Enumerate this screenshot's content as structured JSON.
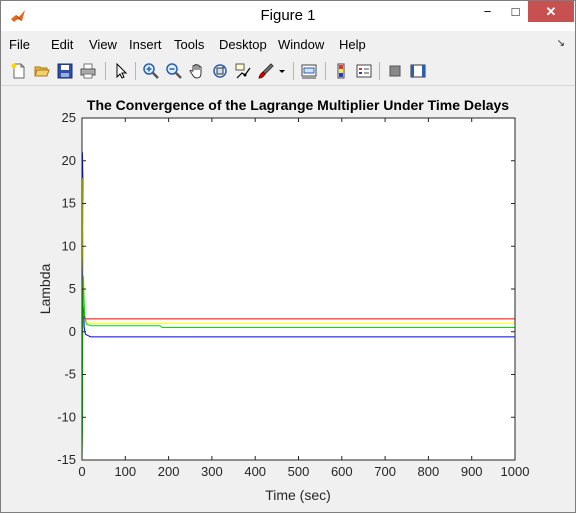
{
  "window": {
    "title": "Figure 1",
    "controls": {
      "minimize": "−",
      "maximize": "□",
      "close": "✕"
    }
  },
  "menu": {
    "items": [
      "File",
      "Edit",
      "View",
      "Insert",
      "Tools",
      "Desktop",
      "Window",
      "Help"
    ],
    "dock_arrow": "↘"
  },
  "toolbar": {
    "buttons": [
      {
        "name": "new-figure-icon"
      },
      {
        "name": "open-file-icon"
      },
      {
        "name": "save-icon"
      },
      {
        "name": "print-icon"
      },
      {
        "name": "edit-plot-arrow-icon"
      },
      {
        "name": "zoom-in-icon"
      },
      {
        "name": "zoom-out-icon"
      },
      {
        "name": "pan-hand-icon"
      },
      {
        "name": "rotate-3d-icon"
      },
      {
        "name": "data-cursor-icon"
      },
      {
        "name": "brush-icon"
      },
      {
        "name": "brush-dropdown-icon"
      },
      {
        "name": "link-plot-icon"
      },
      {
        "name": "insert-colorbar-icon"
      },
      {
        "name": "insert-legend-icon"
      },
      {
        "name": "hide-plot-tools-icon"
      },
      {
        "name": "show-plot-tools-icon"
      }
    ]
  },
  "chart_data": {
    "type": "line",
    "title": "The Convergence of the Lagrange Multiplier Under Time Delays",
    "xlabel": "Time (sec)",
    "ylabel": "Lambda",
    "xlim": [
      0,
      1000
    ],
    "ylim": [
      -15,
      25
    ],
    "xticks": [
      0,
      100,
      200,
      300,
      400,
      500,
      600,
      700,
      800,
      900,
      1000
    ],
    "yticks": [
      -15,
      -10,
      -5,
      0,
      5,
      10,
      15,
      20,
      25
    ],
    "grid": false,
    "series": [
      {
        "color": "#0000ff",
        "x": [
          0,
          1,
          2,
          3,
          5,
          8,
          12,
          20,
          1000
        ],
        "y": [
          0,
          21,
          18,
          6,
          0.5,
          -0.3,
          -0.4,
          -0.6,
          -0.6
        ]
      },
      {
        "color": "#ffff00",
        "x": [
          0,
          1,
          2,
          3,
          5,
          8,
          12,
          20,
          1000
        ],
        "y": [
          0,
          18,
          14,
          8,
          3,
          1.5,
          1.0,
          1.0,
          1.0
        ]
      },
      {
        "color": "#ff0000",
        "x": [
          0,
          1,
          2,
          4,
          8,
          15,
          1000
        ],
        "y": [
          0,
          5,
          3,
          2,
          1.5,
          1.5,
          1.5
        ]
      },
      {
        "color": "#00dd00",
        "x": [
          0,
          1,
          2,
          3,
          4,
          6,
          10,
          20,
          180,
          185,
          1000
        ],
        "y": [
          -15,
          -12,
          2,
          6.5,
          5,
          2,
          0.9,
          0.7,
          0.7,
          0.5,
          0.5
        ]
      }
    ]
  }
}
